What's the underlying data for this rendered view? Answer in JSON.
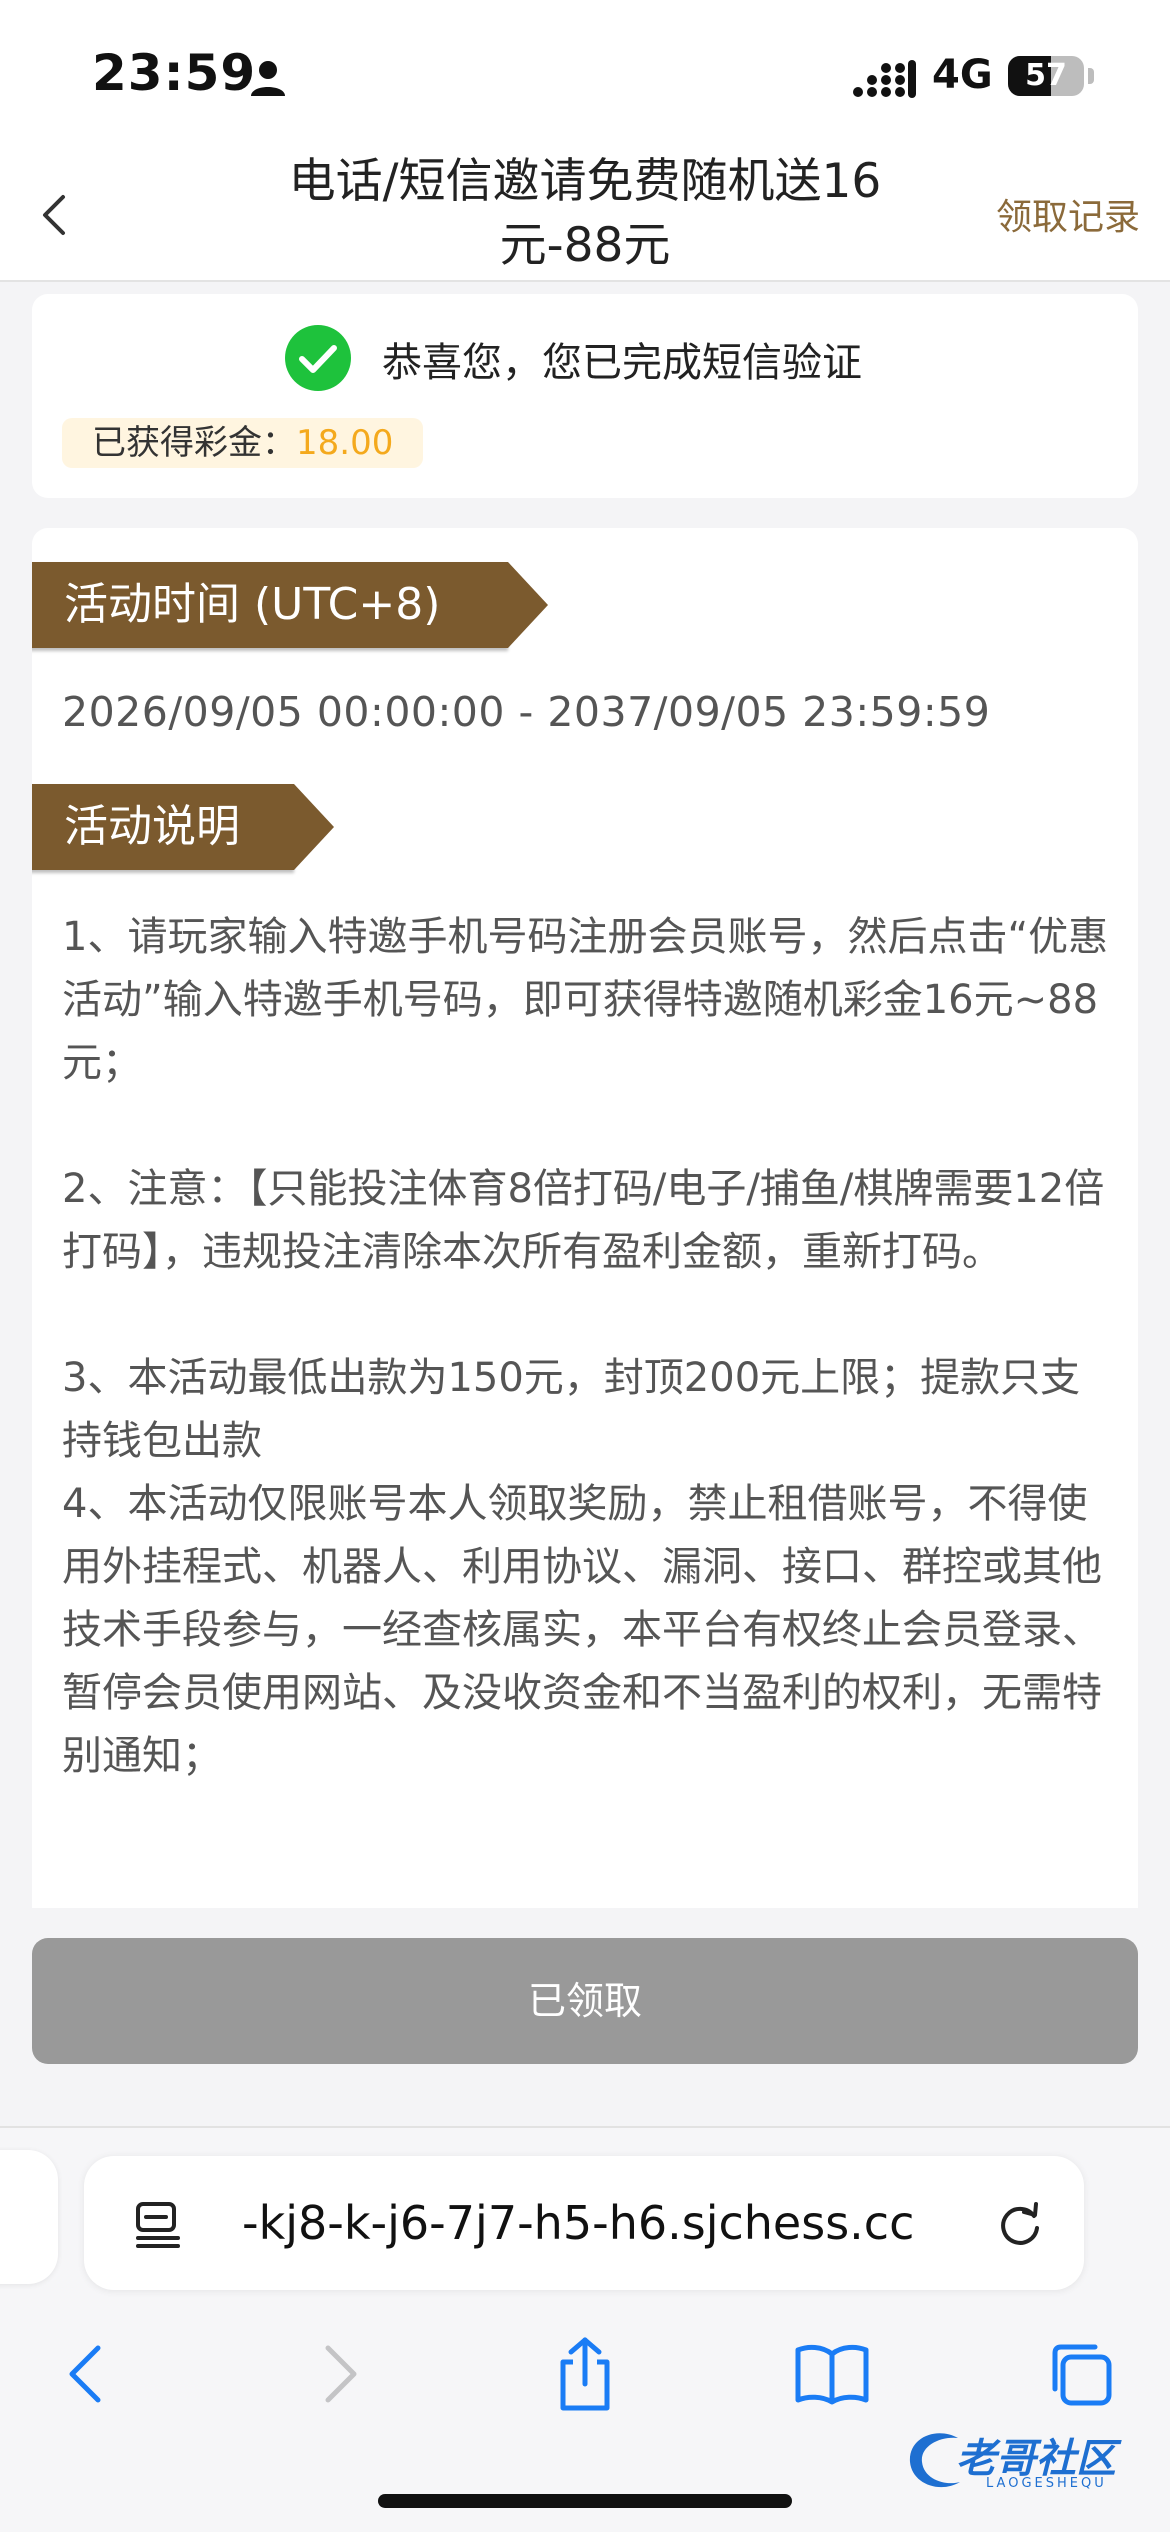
{
  "status_bar": {
    "time": "23:59",
    "network": "4G",
    "battery": "57",
    "battery_level": 0.57
  },
  "header": {
    "title_line1": "电话/短信邀请免费随机送16",
    "title_line2": "元-88元",
    "records_link": "领取记录"
  },
  "verification": {
    "message": "恭喜您，您已完成短信验证",
    "bonus_label": "已获得彩金：",
    "bonus_value": "18.00"
  },
  "activity": {
    "time_title": "活动时间 (UTC+8)",
    "time_range": "2026/09/05 00:00:00 - 2037/09/05 23:59:59",
    "desc_title": "活动说明",
    "rules": [
      "1、请玩家输入特邀手机号码注册会员账号，然后点击“优惠活动”输入特邀手机号码，即可获得特邀随机彩金16元~88元；",
      "2、注意：【只能投注体育8倍打码/电子/捕鱼/棋牌需要12倍打码】，违规投注清除本次所有盈利金额，重新打码。",
      "3、本活动最低出款为150元，封顶200元上限；提款只支持钱包出款",
      "4、本活动仅限账号本人领取奖励，禁止租借账号，不得使用外挂程式、机器人、利用协议、漏洞、接口、群控或其他技术手段参与，一经查核属实，本平台有权终止会员登录、暂停会员使用网站、及没收资金和不当盈利的权利，无需特别通知；"
    ]
  },
  "claim_button": "已领取",
  "browser": {
    "url": "-kj8-k-j6-7j7-h5-h6.sjchess.cc"
  },
  "watermark": {
    "text": "老哥社区",
    "sub": "LAOGESHEQU"
  },
  "colors": {
    "accent_brown": "#7b5a2e",
    "bonus_orange": "#f4a91d",
    "check_green": "#1ec23c",
    "link_blue": "#1a7cf5"
  }
}
